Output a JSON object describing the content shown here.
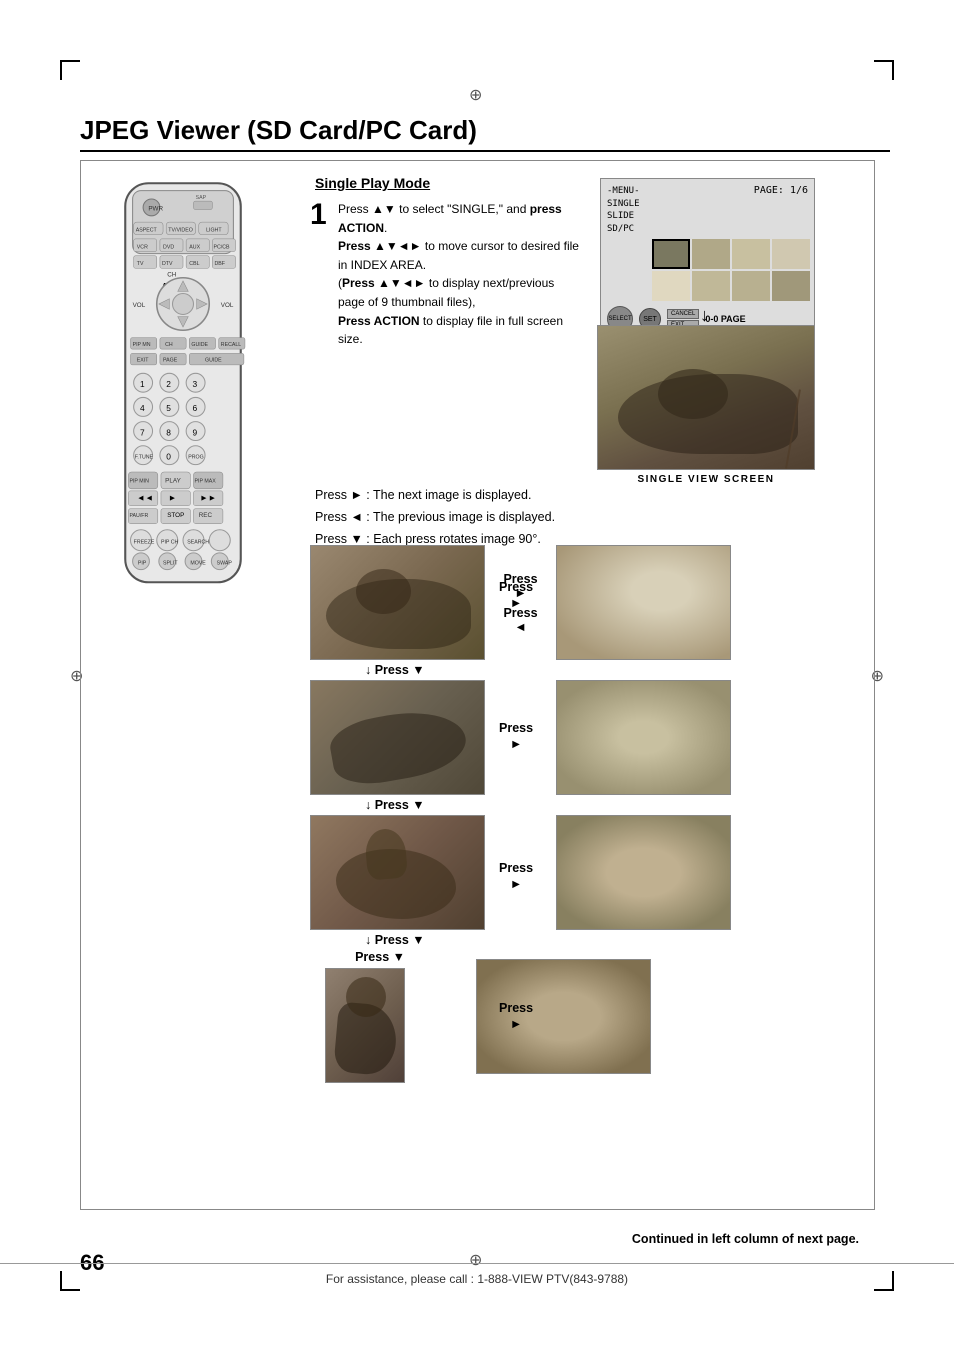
{
  "page": {
    "title": "JPEG Viewer (SD Card/PC Card)",
    "number": "66",
    "footer_text": "For assistance, please call : 1-888-VIEW PTV(843-9788)"
  },
  "section": {
    "heading": "Single Play Mode",
    "step_number": "1",
    "instructions": [
      {
        "text": "Press ▲▼ to select \"SINGLE,\" and ",
        "bold_part": "press ACTION."
      },
      {
        "text": "Press ▲▼◄► to move cursor to desired file in INDEX AREA."
      },
      {
        "text": "(Press ▲▼◄► to display next/previous page of 9 thumbnail files),"
      },
      {
        "text": "Press ACTION to display file in full screen size.",
        "bold_prefix": "Press ACTION"
      }
    ],
    "full_step_text": "Press ▲▼ to select \"SINGLE,\" and press ACTION.\nPress ▲▼◄► to move cursor to desired file in INDEX AREA.\n(Press ▲▼◄► to display next/previous page of 9 thumbnail files),\nPress ACTION to display file in full screen size."
  },
  "index_screen": {
    "menu_line1": "-MENU-",
    "menu_line2": "SINGLE",
    "menu_line3": "SLIDE",
    "menu_line4": "SD/PC",
    "page_label": "PAGE:",
    "page_value": "1/6"
  },
  "single_view_label": "SINGLE VIEW SCREEN",
  "press_instructions": [
    "Press ► : The next image is displayed.",
    "Press ◄ : The previous image is displayed.",
    "Press ▼ : Each press rotates image 90°."
  ],
  "flow_labels": {
    "press_right": "Press\n►",
    "press_left": "Press\n◄",
    "press_down1": "↓ Press ▼",
    "press_down2": "↓ Press ▼",
    "press_down3": "↓ Press ▼",
    "press_down4": "Press ▼",
    "press_right2": "Press\n►",
    "press_right3": "Press\n►",
    "press_right4": "Press\n►"
  },
  "continued_text": "Continued in left column of next page.",
  "icons": {
    "crosshair": "⊕",
    "arrow_down": "↓",
    "arrow_right": "►",
    "arrow_left": "◄",
    "arrow_up_down": "▲▼"
  }
}
